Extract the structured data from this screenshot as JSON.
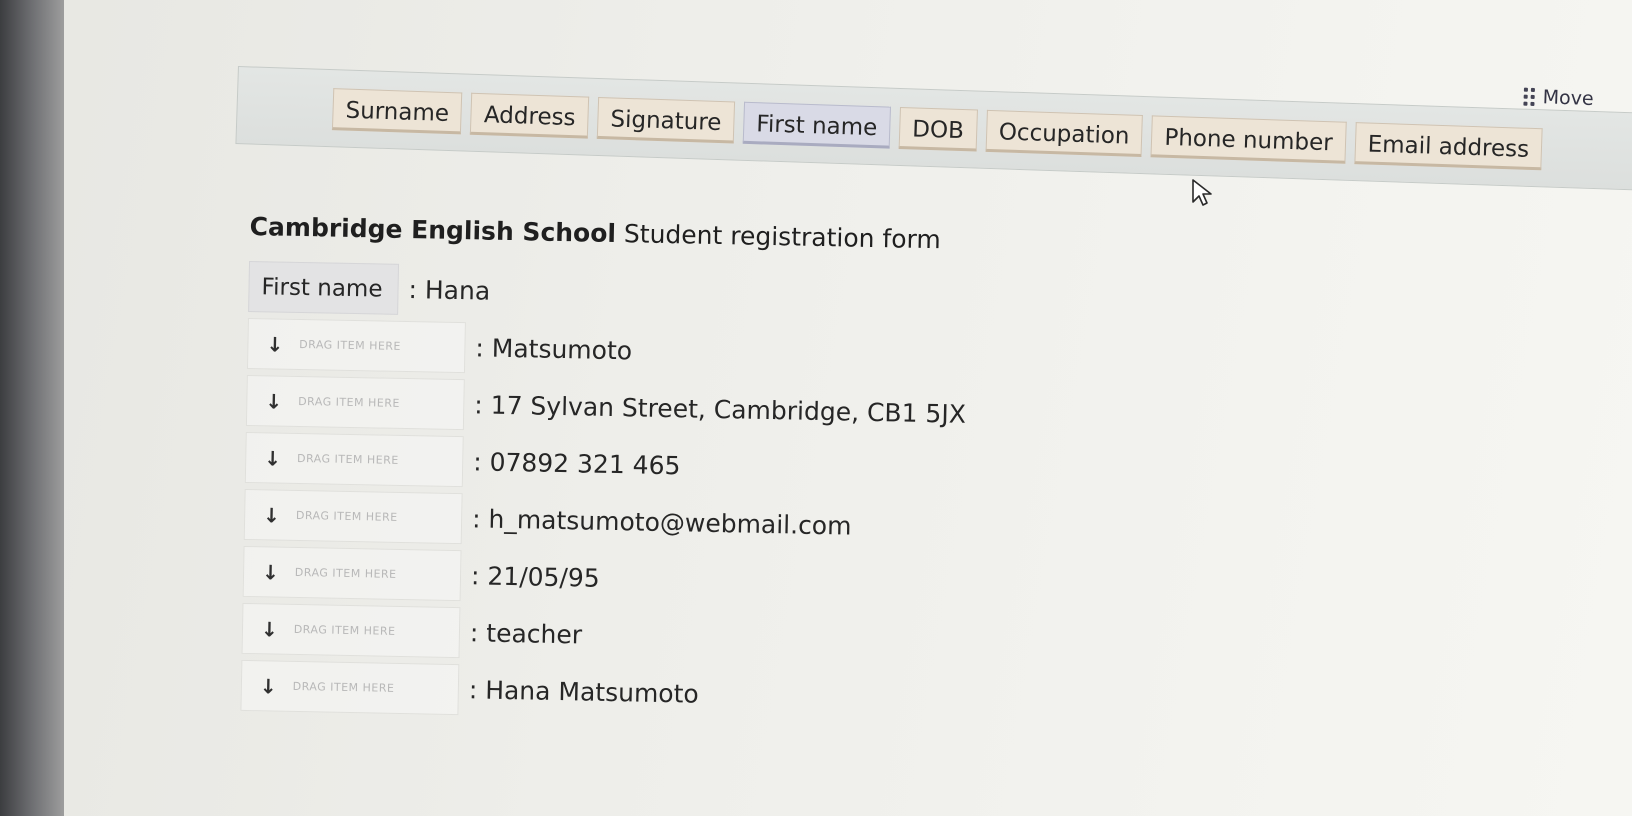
{
  "toolbar": {
    "move_label": "Move",
    "items": [
      {
        "label": "Surname"
      },
      {
        "label": "Address"
      },
      {
        "label": "Signature"
      },
      {
        "label": "First name"
      },
      {
        "label": "DOB"
      },
      {
        "label": "Occupation"
      },
      {
        "label": "Phone number"
      },
      {
        "label": "Email address"
      }
    ]
  },
  "form": {
    "title_bold": "Cambridge English School",
    "title_rest": " Student registration form",
    "placeholder": "DRAG ITEM HERE",
    "filled_label": "First name",
    "rows": [
      {
        "value": ": Hana"
      },
      {
        "value": ": Matsumoto"
      },
      {
        "value": ": 17 Sylvan Street, Cambridge, CB1 5JX"
      },
      {
        "value": ": 07892 321 465"
      },
      {
        "value": ": h_matsumoto@webmail.com"
      },
      {
        "value": ": 21/05/95"
      },
      {
        "value": ": teacher"
      },
      {
        "value": ": Hana Matsumoto"
      }
    ]
  },
  "colors": {
    "chip_bg": "#ede4d6",
    "chip_active_bg": "#d9dae6",
    "toolbar_bg": "#dcdfdd",
    "page_bg": "#eeeeea"
  },
  "icons": {
    "slot_arrow": "arrow-down-icon",
    "move": "grip-icon",
    "pointer": "mouse-pointer-icon"
  }
}
